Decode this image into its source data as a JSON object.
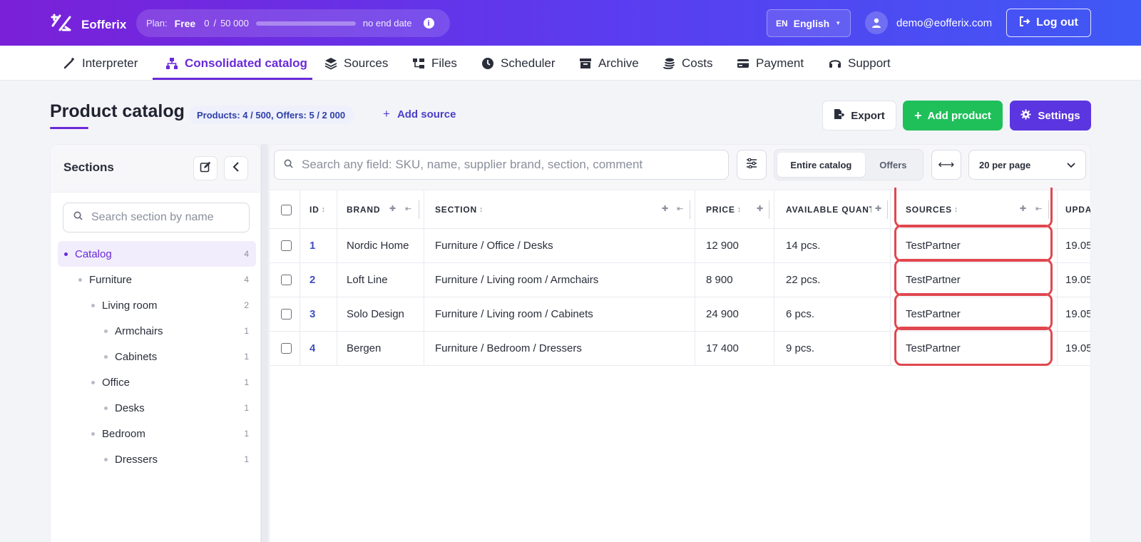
{
  "app": {
    "name": "Eofferix"
  },
  "plan": {
    "label": "Plan:",
    "name": "Free",
    "used": "0",
    "sep": "/",
    "limit": "50 000",
    "progress": 0,
    "end": "no end date"
  },
  "lang": {
    "code": "EN",
    "name": "English"
  },
  "user": {
    "email": "demo@eofferix.com"
  },
  "logout_label": "Log out",
  "nav": [
    {
      "label": "Interpreter",
      "icon": "wand-icon"
    },
    {
      "label": "Consolidated catalog",
      "icon": "sitemap-icon",
      "active": true
    },
    {
      "label": "Sources",
      "icon": "layers-icon"
    },
    {
      "label": "Files",
      "icon": "folder-tree-icon"
    },
    {
      "label": "Scheduler",
      "icon": "clock-icon"
    },
    {
      "label": "Archive",
      "icon": "archive-icon"
    },
    {
      "label": "Costs",
      "icon": "coins-icon"
    },
    {
      "label": "Payment",
      "icon": "credit-card-icon"
    },
    {
      "label": "Support",
      "icon": "headset-icon"
    }
  ],
  "page": {
    "title": "Product catalog",
    "counts": "Products: 4 / 500, Offers: 5 / 2 000",
    "add_source": "Add source",
    "export": "Export",
    "add_product": "Add product",
    "settings": "Settings"
  },
  "sidebar": {
    "title": "Sections",
    "search_placeholder": "Search section by name",
    "tree": [
      {
        "label": "Catalog",
        "count": "4",
        "level": 0,
        "selected": true
      },
      {
        "label": "Furniture",
        "count": "4",
        "level": 1
      },
      {
        "label": "Living room",
        "count": "2",
        "level": 2
      },
      {
        "label": "Armchairs",
        "count": "1",
        "level": 3
      },
      {
        "label": "Cabinets",
        "count": "1",
        "level": 3
      },
      {
        "label": "Office",
        "count": "1",
        "level": 2
      },
      {
        "label": "Desks",
        "count": "1",
        "level": 3
      },
      {
        "label": "Bedroom",
        "count": "1",
        "level": 2
      },
      {
        "label": "Dressers",
        "count": "1",
        "level": 3
      }
    ]
  },
  "toolbar": {
    "search_placeholder": "Search any field: SKU, name, supplier brand, section, comment",
    "scope_all": "Entire catalog",
    "scope_offers": "Offers",
    "per_page": "20 per page"
  },
  "table": {
    "headers": {
      "id": "ID",
      "brand": "BRAND",
      "section": "SECTION",
      "price": "PRICE",
      "qty": "AVAILABLE QUANT",
      "sources": "SOURCES",
      "updated": "UPDA"
    },
    "rows": [
      {
        "id": "1",
        "brand": "Nordic Home",
        "section": "Furniture / Office / Desks",
        "price": "12 900",
        "qty": "14 pcs.",
        "sources": "TestPartner",
        "updated": "19.05"
      },
      {
        "id": "2",
        "brand": "Loft Line",
        "section": "Furniture / Living room / Armchairs",
        "price": "8 900",
        "qty": "22 pcs.",
        "sources": "TestPartner",
        "updated": "19.05"
      },
      {
        "id": "3",
        "brand": "Solo Design",
        "section": "Furniture / Living room / Cabinets",
        "price": "24 900",
        "qty": "6 pcs.",
        "sources": "TestPartner",
        "updated": "19.05"
      },
      {
        "id": "4",
        "brand": "Bergen",
        "section": "Furniture / Bedroom / Dressers",
        "price": "17 400",
        "qty": "9 pcs.",
        "sources": "TestPartner",
        "updated": "19.05"
      }
    ]
  },
  "colors": {
    "accent": "#6a2ad8",
    "success": "#1fbf5a",
    "highlight": "#e0474f"
  }
}
